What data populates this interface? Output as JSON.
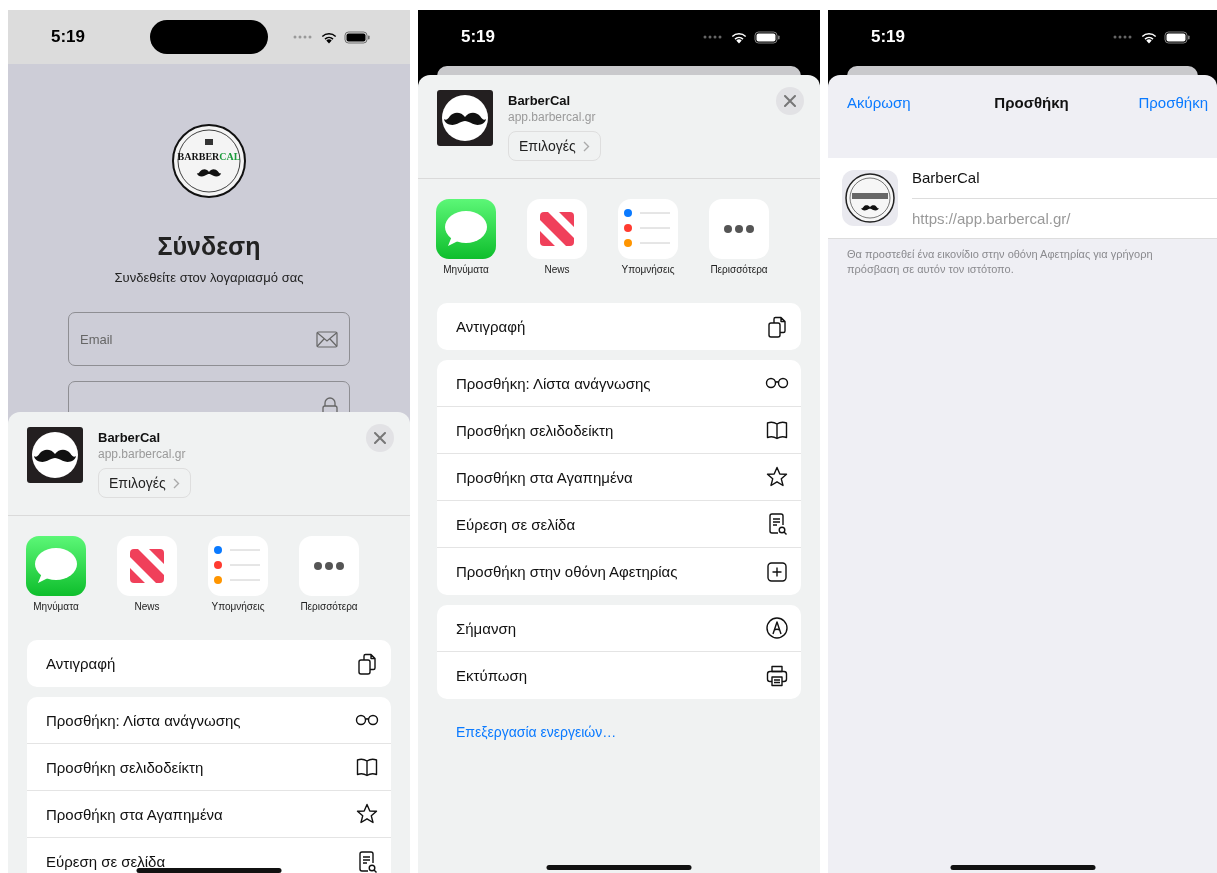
{
  "screens": [
    {
      "kind": "login",
      "status_bar": {
        "time": "5:19"
      },
      "logo": {
        "wordmark": [
          "BARBER",
          "CAL"
        ]
      },
      "title": "Σύνδεση",
      "subtitle": "Συνδεθείτε στον λογαριασμό σας",
      "fields": [
        {
          "kind": "email",
          "placeholder": "Email"
        },
        {
          "kind": "password"
        }
      ],
      "share_sheet": {
        "title": "BarberCal",
        "url": "app.barbercal.gr",
        "options_button": "Επιλογές",
        "apps": [
          {
            "kind": "messages",
            "label": "Μηνύματα"
          },
          {
            "kind": "news",
            "label": "News"
          },
          {
            "kind": "reminders",
            "label": "Υπομνήσεις"
          },
          {
            "kind": "more",
            "label": "Περισσότερα"
          }
        ],
        "action_groups": [
          [
            {
              "kind": "copy",
              "label": "Αντιγραφή"
            }
          ],
          [
            {
              "kind": "reading_list",
              "label": "Προσθήκη: Λίστα ανάγνωσης"
            },
            {
              "kind": "bookmark",
              "label": "Προσθήκη σελιδοδείκτη"
            },
            {
              "kind": "favorite",
              "label": "Προσθήκη στα Αγαπημένα"
            },
            {
              "kind": "find",
              "label": "Εύρεση σε σελίδα"
            }
          ]
        ]
      }
    },
    {
      "kind": "share",
      "status_bar": {
        "time": "5:19"
      },
      "share_sheet": {
        "title": "BarberCal",
        "url": "app.barbercal.gr",
        "options_button": "Επιλογές",
        "apps": [
          {
            "kind": "messages",
            "label": "Μηνύματα"
          },
          {
            "kind": "news",
            "label": "News"
          },
          {
            "kind": "reminders",
            "label": "Υπομνήσεις"
          },
          {
            "kind": "more",
            "label": "Περισσότερα"
          }
        ],
        "action_groups": [
          [
            {
              "kind": "copy",
              "label": "Αντιγραφή"
            }
          ],
          [
            {
              "kind": "reading_list",
              "label": "Προσθήκη: Λίστα ανάγνωσης"
            },
            {
              "kind": "bookmark",
              "label": "Προσθήκη σελιδοδείκτη"
            },
            {
              "kind": "favorite",
              "label": "Προσθήκη στα Αγαπημένα"
            },
            {
              "kind": "find",
              "label": "Εύρεση σε σελίδα"
            },
            {
              "kind": "home_screen",
              "label": "Προσθήκη στην οθόνη Αφετηρίας"
            }
          ],
          [
            {
              "kind": "markup",
              "label": "Σήμανση"
            },
            {
              "kind": "print",
              "label": "Εκτύπωση"
            }
          ]
        ],
        "edit_link": "Επεξεργασία ενεργειών…"
      }
    },
    {
      "kind": "add_to_home",
      "status_bar": {
        "time": "5:19"
      },
      "nav": {
        "cancel": "Ακύρωση",
        "title": "Προσθήκη",
        "confirm": "Προσθήκη"
      },
      "name_field": {
        "value": "BarberCal"
      },
      "url": "https://app.barbercal.gr/",
      "note": "Θα προστεθεί ένα εικονίδιο στην οθόνη Αφετηρίας για γρήγορη πρόσβαση σε αυτόν τον ιστότοπο."
    }
  ]
}
